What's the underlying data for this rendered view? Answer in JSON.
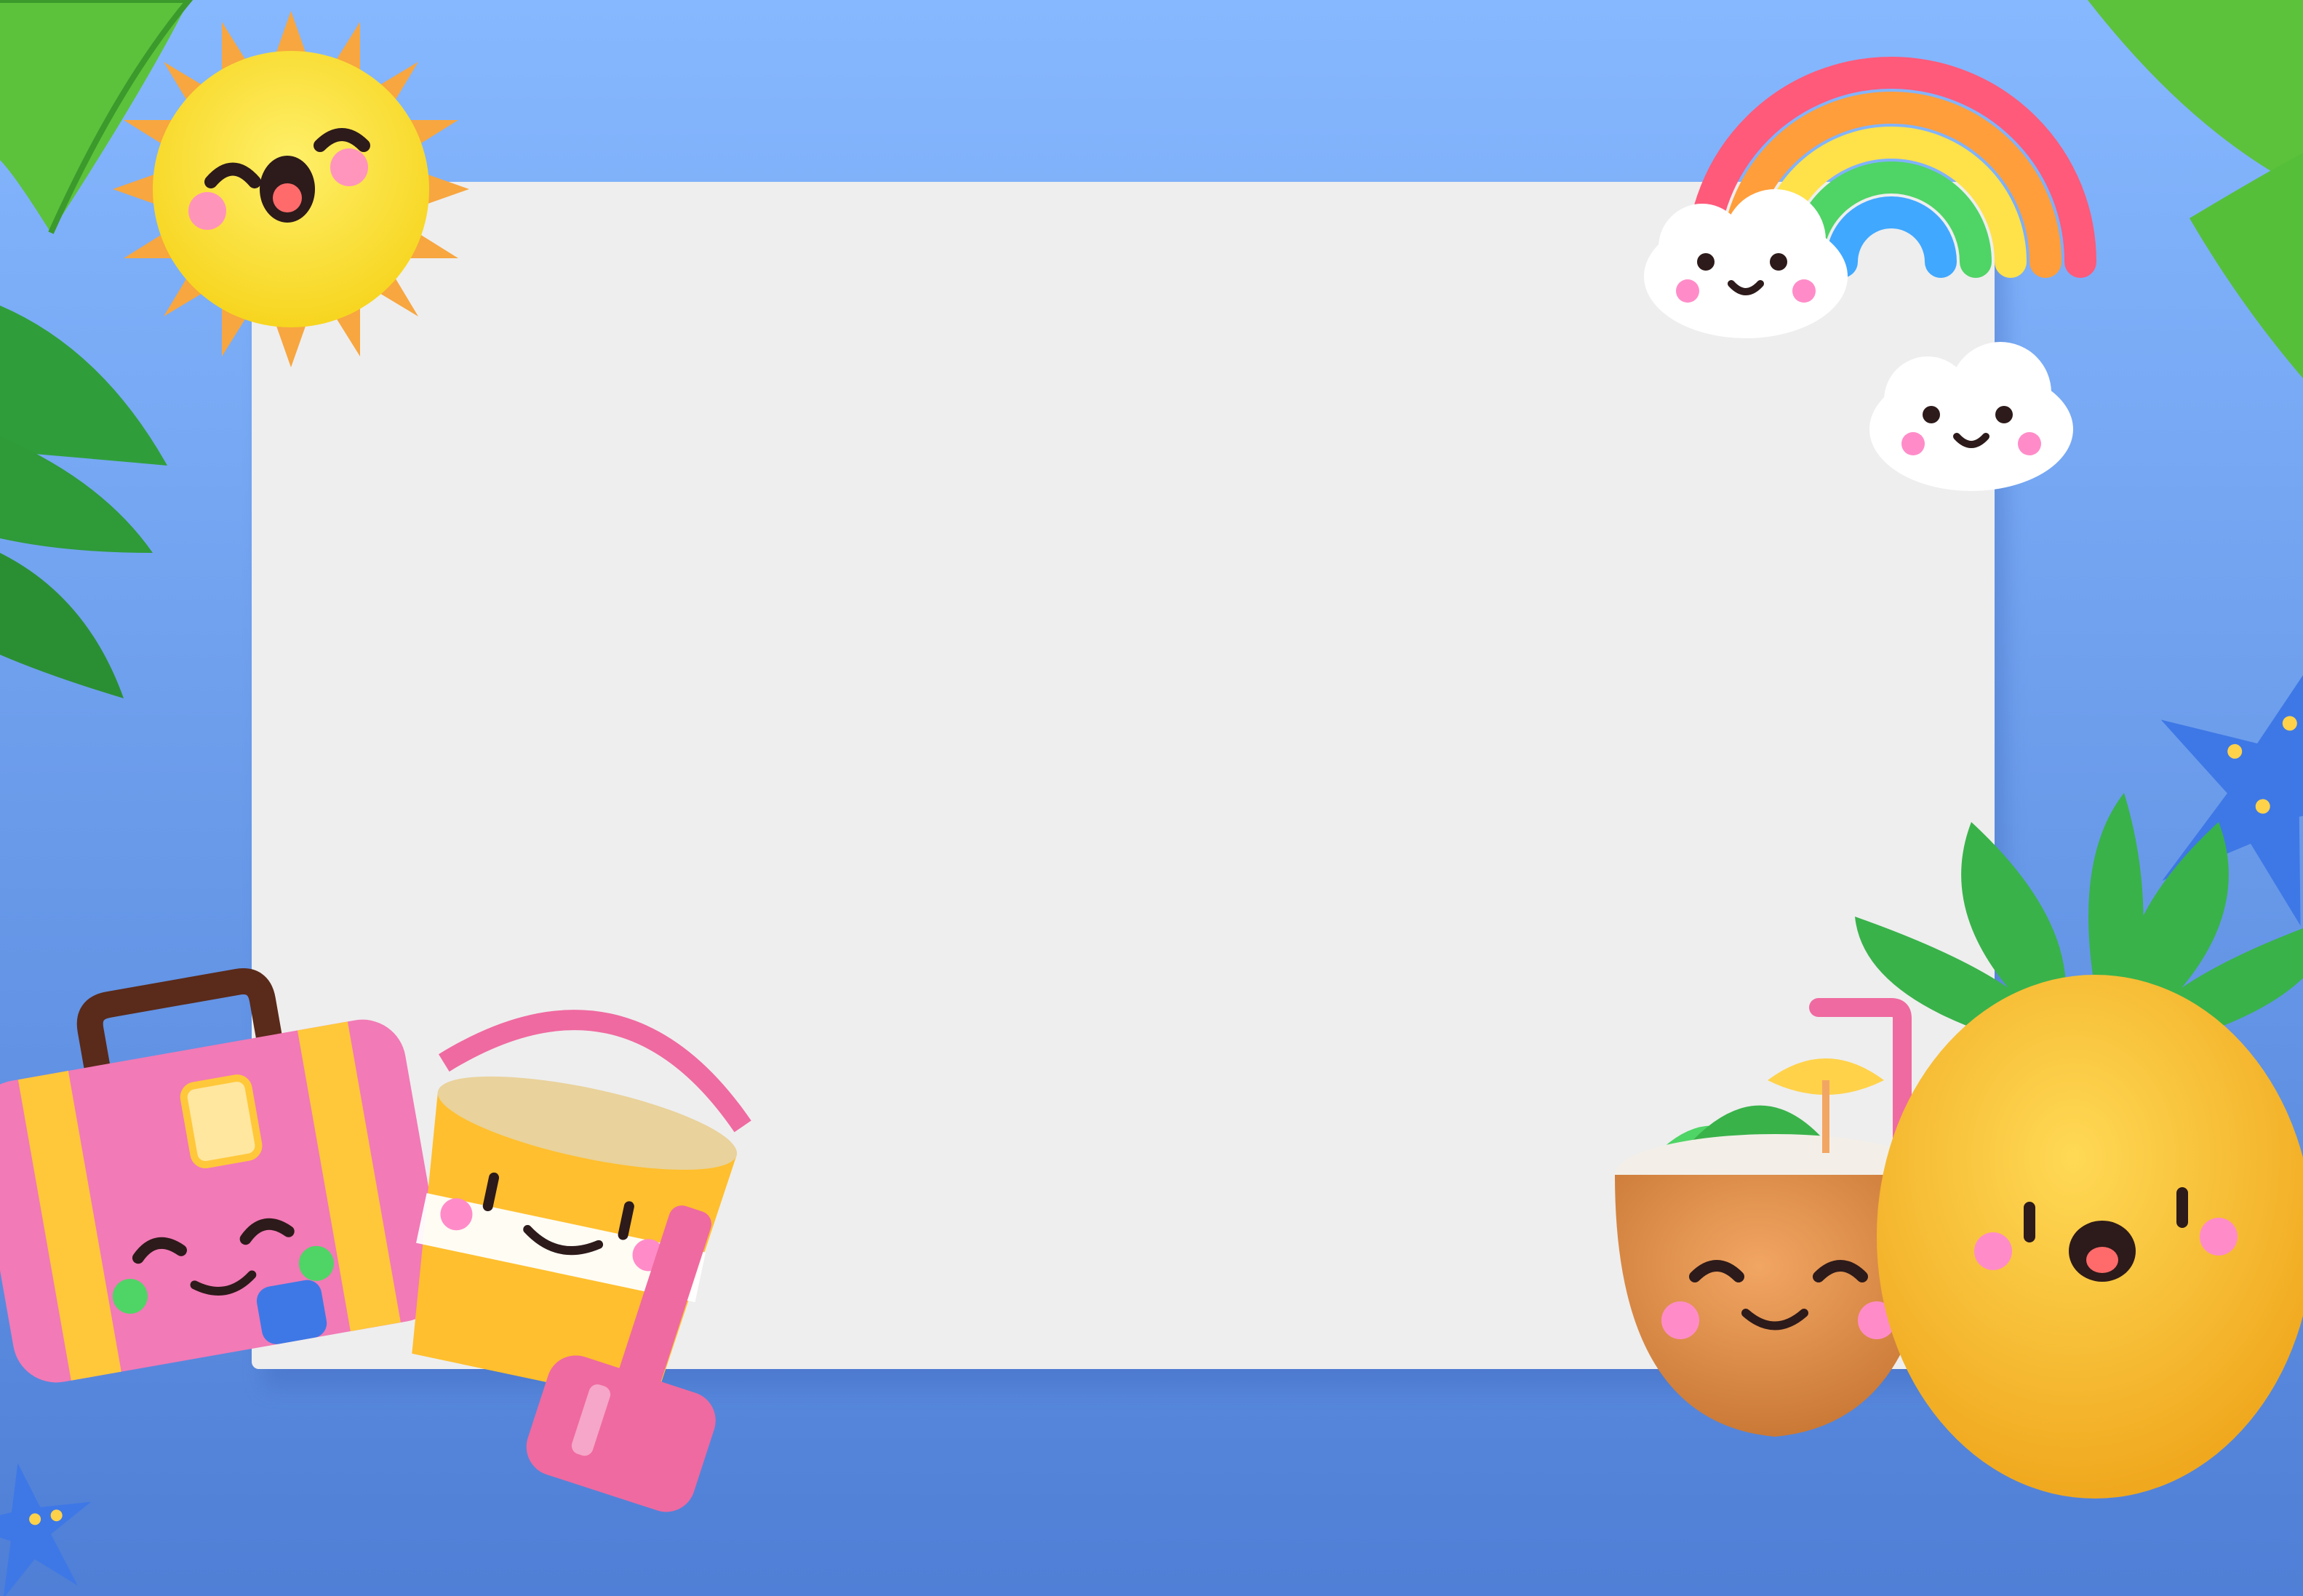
{
  "scene": {
    "description_visible_text": "",
    "colors": {
      "background_top": "#86b8ff",
      "background_bottom": "#4f7fd6",
      "card": "#eeeeee",
      "card_shadow": "#3b64b8",
      "sun": "#f7d51f",
      "sun_rays": "#f7a640",
      "suitcase": "#f27ab6",
      "suitcase_straps": "#ffc83a",
      "bucket": "#ffbf2e",
      "bucket_handle": "#ef6aa0",
      "coconut": "#d98a45",
      "pineapple": "#f7c02d",
      "pineapple_leaves": "#39b24a",
      "leaf_green": "#5cc23c",
      "starfish": "#3e78e6",
      "rainbow_red": "#ff5a7a",
      "rainbow_orange": "#ff9e3a",
      "rainbow_yellow": "#ffe14a",
      "rainbow_green": "#4fd466",
      "rainbow_blue": "#40a8ff",
      "rainbow_purple": "#8a63ff",
      "cloud": "#ffffff",
      "face_dark": "#2d1a1a",
      "cheek_pink": "#ff8cc8"
    },
    "icons": [
      "sun-icon",
      "rainbow-icon",
      "cloud-icon",
      "suitcase-icon",
      "sand-bucket-icon",
      "shovel-icon",
      "coconut-drink-icon",
      "pineapple-icon",
      "palm-leaf-icon",
      "starfish-icon"
    ]
  }
}
